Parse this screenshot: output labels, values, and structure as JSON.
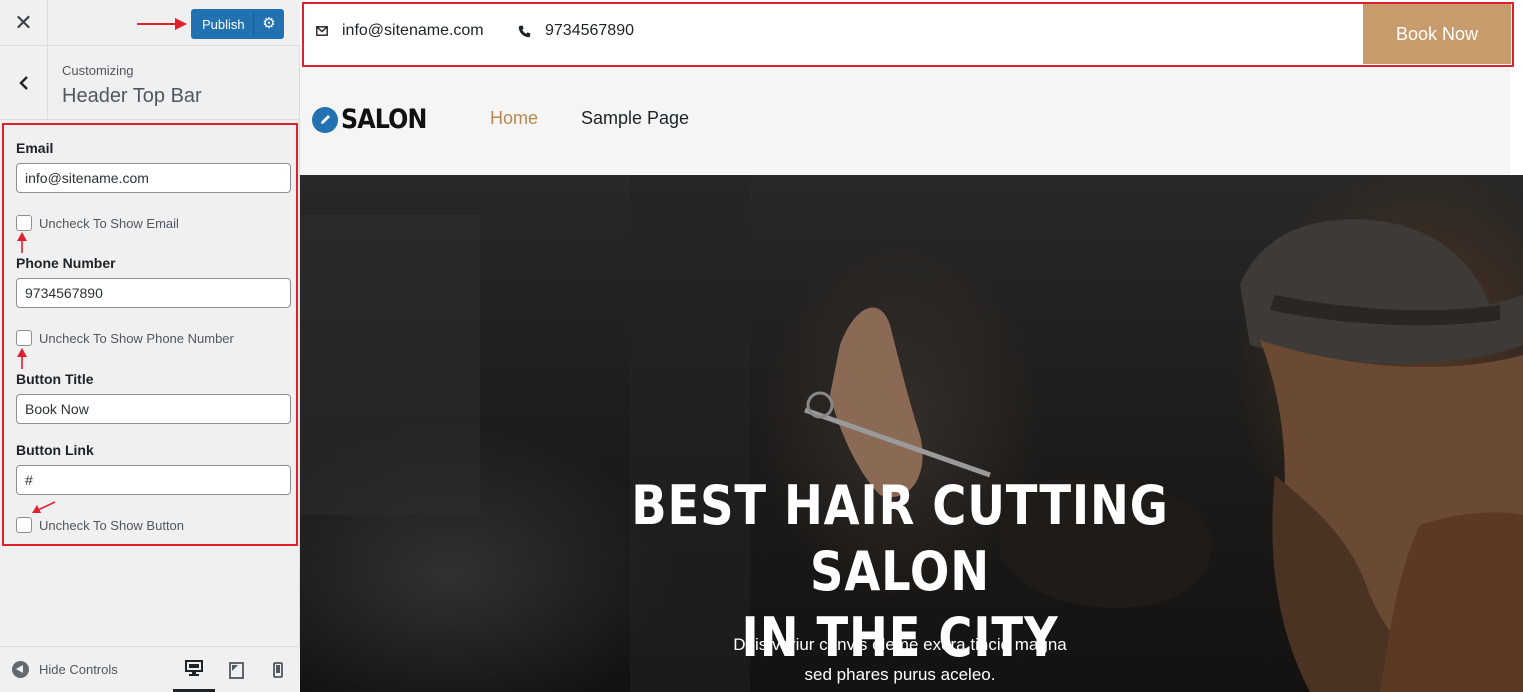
{
  "customizer": {
    "close_icon": "close-icon",
    "publish_label": "Publish",
    "publish_settings_icon": "gear-icon",
    "back_icon": "chevron-left-icon",
    "breadcrumb": "Customizing",
    "section_title": "Header Top Bar",
    "controls": {
      "email_label": "Email",
      "email_value": "info@sitename.com",
      "email_toggle_label": "Uncheck To Show Email",
      "phone_label": "Phone Number",
      "phone_value": "9734567890",
      "phone_toggle_label": "Uncheck To Show Phone Number",
      "button_title_label": "Button Title",
      "button_title_value": "Book Now",
      "button_link_label": "Button Link",
      "button_link_value": "#",
      "button_toggle_label": "Uncheck To Show Button"
    },
    "footer": {
      "hide_controls_label": "Hide Controls",
      "devices": [
        "desktop-icon",
        "tablet-icon",
        "mobile-icon"
      ],
      "active_device": "desktop"
    }
  },
  "preview": {
    "topbar": {
      "email": "info@sitename.com",
      "phone": "9734567890",
      "button_label": "Book Now"
    },
    "logo_text": "SALON",
    "nav": [
      "Home",
      "Sample Page"
    ],
    "active_nav": "Home",
    "hero": {
      "title_line1": "BEST HAIR CUTTING SALON",
      "title_line2": "IN THE CITY",
      "subtitle_line1": "Duis variur convls eleme exera tincid magna",
      "subtitle_line2": "sed phares purus aceleo."
    }
  },
  "colors": {
    "wp_blue": "#2271b1",
    "accent_tan": "#c89b6d",
    "highlight_red": "#e0212d",
    "nav_active": "#b9884f"
  }
}
